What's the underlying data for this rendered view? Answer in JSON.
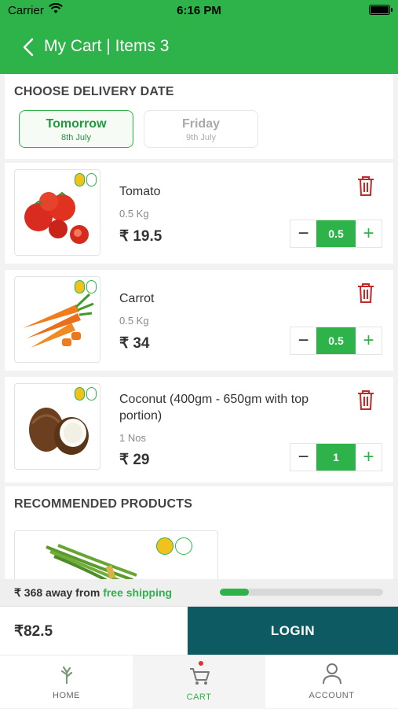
{
  "status_bar": {
    "carrier": "Carrier",
    "time": "6:16 PM"
  },
  "header": {
    "title": "My Cart | Items 3"
  },
  "delivery": {
    "section_title": "CHOOSE DELIVERY DATE",
    "dates": [
      {
        "day": "Tomorrow",
        "date": "8th July",
        "selected": true
      },
      {
        "day": "Friday",
        "date": "9th July",
        "selected": false
      }
    ]
  },
  "cart_items": [
    {
      "name": "Tomato",
      "quantity": "0.5 Kg",
      "price": "₹ 19.5",
      "count": "0.5",
      "image": "tomato-image"
    },
    {
      "name": "Carrot",
      "quantity": "0.5 Kg",
      "price": "₹ 34",
      "count": "0.5",
      "image": "carrot-image"
    },
    {
      "name": "Coconut (400gm - 650gm with top portion)",
      "quantity": "1 Nos",
      "price": "₹ 29",
      "count": "1",
      "image": "coconut-image"
    }
  ],
  "recommended": {
    "section_title": "RECOMMENDED PRODUCTS",
    "product_image": "beans-image"
  },
  "shipping": {
    "amount_text": "₹ 368 away from ",
    "free_text": "free shipping",
    "progress_fraction": 0.18
  },
  "footer": {
    "total": "₹82.5",
    "login_label": "LOGIN"
  },
  "tabs": [
    {
      "label": "HOME",
      "icon": "leaf-icon",
      "active": false
    },
    {
      "label": "CART",
      "icon": "cart-icon",
      "active": true
    },
    {
      "label": "ACCOUNT",
      "icon": "person-icon",
      "active": false
    }
  ],
  "colors": {
    "brand_green": "#2db34a",
    "login_teal": "#0d5a63",
    "delete_red": "#c62828"
  }
}
